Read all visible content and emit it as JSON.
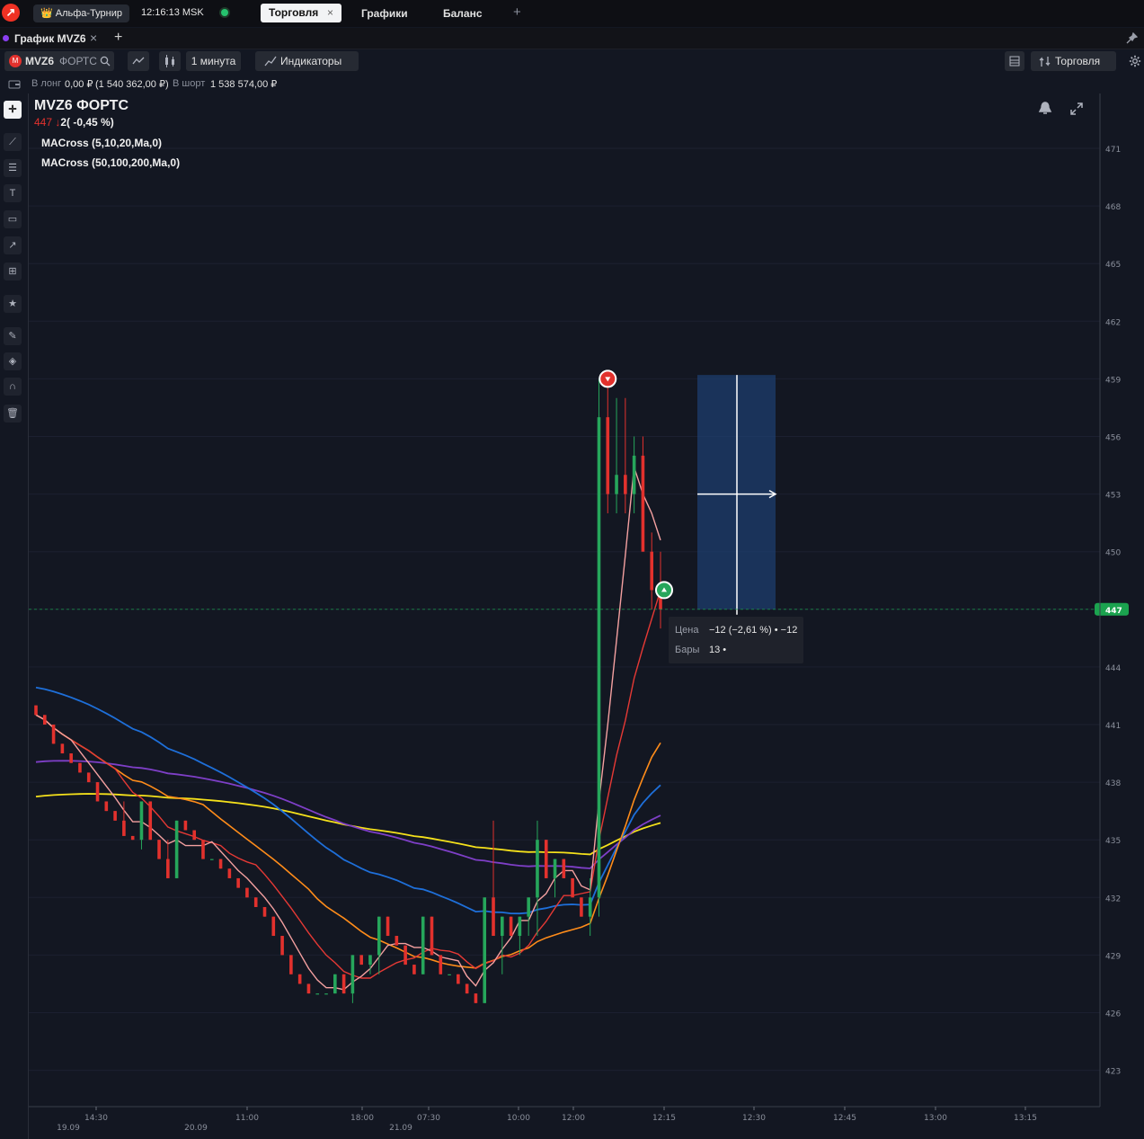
{
  "topbar": {
    "logo_glyph": "↗",
    "account": "👑 Альфа-Турнир",
    "clock": "12:16:13 MSK",
    "tabs": [
      {
        "label": "Торговля",
        "close": "×"
      },
      {
        "label": "Графики"
      },
      {
        "label": "Баланс"
      }
    ],
    "add_tab": "+"
  },
  "subbar": {
    "tab_label": "График MVZ6",
    "close": "×",
    "add": "+",
    "pin_icon": "pin-icon"
  },
  "toolbar": {
    "symbol": "MVZ6",
    "exchange": "ФОРТС",
    "interval": "1 минута",
    "indicators": "Индикаторы",
    "trade": "Торговля"
  },
  "positions": {
    "long_label": "В лонг",
    "long_value": "0,00 ₽",
    "long_extra": "(1 540 362,00 ₽)",
    "short_label": "В шорт",
    "short_value": "1 538 574,00 ₽"
  },
  "legend": {
    "title": "MVZ6 ФОРТС",
    "price": "447",
    "change_arrow": "↓",
    "change": "2( -0,45 %)",
    "indicator1": "MACross (5,10,20,Ma,0)",
    "indicator2": "MACross (50,100,200,Ma,0)"
  },
  "measure_tooltip": {
    "price_label": "Цена",
    "price_value": "−12 (−2,61 %) • −12",
    "bars_label": "Бары",
    "bars_value": "13 •"
  },
  "colors": {
    "bg": "#131722",
    "up": "#26a65b",
    "down": "#e2312d",
    "ma5": "#f4a0a0",
    "ma10": "#e53935",
    "ma20": "#ff8c1a",
    "ma50": "#1e6fd9",
    "ma100": "#7e3fc7",
    "ma200": "#f5e11b",
    "current_price": "#1ba34f"
  },
  "chart_data": {
    "type": "candlestick",
    "symbol": "MVZ6",
    "interval": "1 минута",
    "ylim": [
      421,
      474
    ],
    "y_ticks": [
      471,
      468,
      465,
      462,
      459,
      456,
      453,
      450,
      447,
      444,
      441,
      438,
      435,
      432,
      429,
      426,
      423
    ],
    "current_price": 447,
    "x_ticks": [
      "14:30",
      "11:00",
      "18:00",
      "07:30",
      "10:00",
      "12:00",
      "12:15",
      "12:30",
      "12:45",
      "13:00",
      "13:15"
    ],
    "date_ticks": [
      "19.09",
      "20.09",
      "21.09"
    ],
    "candles_ohlc": [
      [
        442,
        442,
        441.5,
        441.5
      ],
      [
        441.5,
        441.5,
        441,
        441
      ],
      [
        441,
        441,
        440,
        440
      ],
      [
        440,
        440,
        439.5,
        439.5
      ],
      [
        439.5,
        439.5,
        439,
        439
      ],
      [
        439,
        439,
        438.5,
        438.5
      ],
      [
        438.5,
        438.5,
        438,
        438
      ],
      [
        438,
        438,
        437,
        437
      ],
      [
        437,
        437,
        436.5,
        436.5
      ],
      [
        436.5,
        436.5,
        436,
        436
      ],
      [
        436,
        437,
        435.2,
        435.2
      ],
      [
        435.2,
        435.2,
        435,
        435
      ],
      [
        435,
        437,
        434.5,
        437
      ],
      [
        437,
        437,
        435,
        435
      ],
      [
        435,
        435,
        434,
        434
      ],
      [
        434,
        435,
        433,
        433
      ],
      [
        433,
        436,
        433,
        436
      ],
      [
        436,
        436,
        435.5,
        435.5
      ],
      [
        435.5,
        435.5,
        435,
        435
      ],
      [
        435,
        435,
        434,
        434
      ],
      [
        434,
        434,
        434,
        434
      ],
      [
        434,
        434,
        433.5,
        433.5
      ],
      [
        433.5,
        433.5,
        433,
        433
      ],
      [
        433,
        433,
        432.5,
        432.5
      ],
      [
        432.5,
        432.5,
        432,
        432
      ],
      [
        432,
        432,
        431.5,
        431.5
      ],
      [
        431.5,
        431.5,
        431,
        431
      ],
      [
        431,
        431,
        430,
        430
      ],
      [
        430,
        430,
        429,
        429
      ],
      [
        429,
        429,
        428,
        428
      ],
      [
        428,
        428,
        427.5,
        427.5
      ],
      [
        427.5,
        427.5,
        427,
        427
      ],
      [
        427,
        427,
        427,
        427
      ],
      [
        427,
        427,
        427,
        427
      ],
      [
        427,
        428,
        427,
        428
      ],
      [
        428,
        428,
        427,
        427
      ],
      [
        427,
        429,
        426.5,
        429
      ],
      [
        429,
        429,
        428.5,
        428.5
      ],
      [
        428.5,
        429,
        428,
        429
      ],
      [
        429,
        431,
        428,
        431
      ],
      [
        431,
        431,
        430,
        430
      ],
      [
        430,
        430,
        429.5,
        429.5
      ],
      [
        429.5,
        429.5,
        428.5,
        428.5
      ],
      [
        428.5,
        428.5,
        428,
        428
      ],
      [
        428,
        431,
        428,
        431
      ],
      [
        431,
        431,
        429,
        429
      ],
      [
        429,
        429,
        428,
        428
      ],
      [
        428,
        428,
        428,
        428
      ],
      [
        428,
        428,
        427.5,
        427.5
      ],
      [
        427.5,
        427.5,
        427,
        427
      ],
      [
        427,
        427,
        426.5,
        426.5
      ],
      [
        426.5,
        432,
        426.5,
        432
      ],
      [
        432,
        436,
        431,
        430
      ],
      [
        430,
        431,
        428,
        431
      ],
      [
        431,
        431,
        430,
        430
      ],
      [
        430,
        431,
        429,
        431
      ],
      [
        431,
        432,
        430,
        432
      ],
      [
        432,
        436,
        430,
        435
      ],
      [
        435,
        435,
        433,
        433
      ],
      [
        433,
        434,
        432,
        434
      ],
      [
        434,
        434,
        433,
        433
      ],
      [
        433,
        433,
        432,
        432
      ],
      [
        432,
        432,
        431,
        431
      ],
      [
        431,
        433,
        430,
        432
      ],
      [
        432,
        459,
        431,
        457
      ],
      [
        457,
        459,
        452,
        453
      ],
      [
        453,
        458,
        452,
        454
      ],
      [
        454,
        458,
        452,
        453
      ],
      [
        453,
        456,
        452,
        455
      ],
      [
        455,
        456,
        451,
        450
      ],
      [
        450,
        451,
        447,
        448
      ],
      [
        448,
        450,
        446,
        447
      ]
    ],
    "series": [
      {
        "name": "MA 5",
        "color": "#f4a0a0"
      },
      {
        "name": "MA 10",
        "color": "#e53935"
      },
      {
        "name": "MA 20",
        "color": "#ff8c1a"
      },
      {
        "name": "MA 50",
        "color": "#1e6fd9"
      },
      {
        "name": "MA 100",
        "color": "#7e3fc7"
      },
      {
        "name": "MA 200",
        "color": "#f5e11b"
      }
    ],
    "measurement": {
      "price_change": -12,
      "price_change_pct": -2.61,
      "bars": 13
    }
  }
}
